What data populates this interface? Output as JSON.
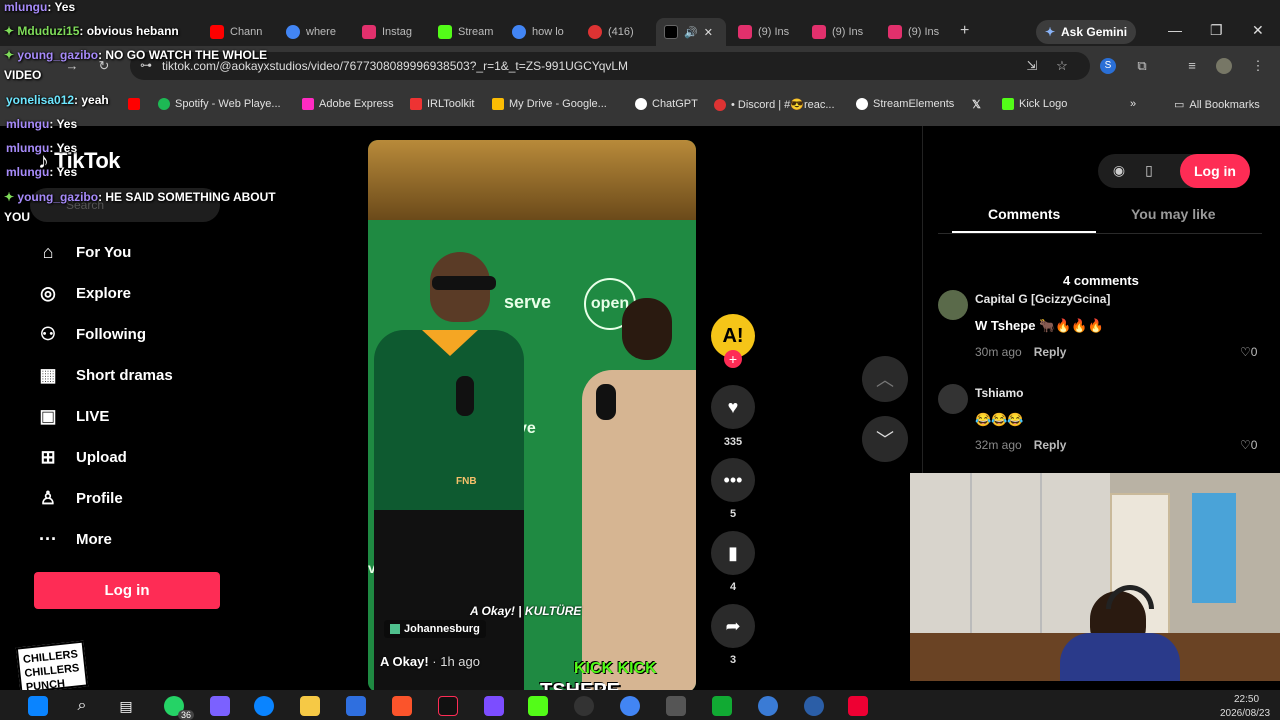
{
  "browser": {
    "tabs": [
      {
        "label": "Chann",
        "color": "#ff0000"
      },
      {
        "label": "where",
        "color": "#4285f4"
      },
      {
        "label": "Instag",
        "color": "#e1306c"
      },
      {
        "label": "Stream",
        "color": "#53fc18"
      },
      {
        "label": "how lo",
        "color": "#4285f4"
      },
      {
        "label": "(416)",
        "color": "#d33"
      },
      {
        "label": "",
        "color": "#000000"
      },
      {
        "label": "(9) Ins",
        "color": "#e1306c"
      },
      {
        "label": "(9) Ins",
        "color": "#e1306c"
      },
      {
        "label": "(9) Ins",
        "color": "#e1306c"
      }
    ],
    "gemini_label": "Ask Gemini",
    "url": "tiktok.com/@aokayxstudios/video/7677308089996938503?_r=1&_t=ZS-991UGCYqvLM",
    "bookmarks": [
      {
        "label": "Spotify - Web Playe...",
        "color": "#1db954"
      },
      {
        "label": "Adobe Express",
        "color": "#ff2bc2"
      },
      {
        "label": "IRLToolkit",
        "color": "#e33"
      },
      {
        "label": "My Drive - Google...",
        "color": "#fbbc04"
      },
      {
        "label": "ChatGPT",
        "color": "#ffffff"
      },
      {
        "label": "• Discord | #😎reac...",
        "color": "#d33"
      },
      {
        "label": "StreamElements",
        "color": "#ffffff"
      },
      {
        "label": "Kick Logo",
        "color": "#53fc18"
      }
    ],
    "all_bookmarks": "All Bookmarks"
  },
  "tiktok": {
    "logo": "TikTok",
    "search_placeholder": "Search",
    "nav": [
      {
        "label": "For You",
        "icon": "home-icon"
      },
      {
        "label": "Explore",
        "icon": "compass-icon"
      },
      {
        "label": "Following",
        "icon": "following-icon"
      },
      {
        "label": "Short dramas",
        "icon": "film-icon"
      },
      {
        "label": "LIVE",
        "icon": "live-icon"
      },
      {
        "label": "Upload",
        "icon": "upload-icon"
      },
      {
        "label": "Profile",
        "icon": "profile-icon"
      },
      {
        "label": "More",
        "icon": "more-icon"
      }
    ],
    "login_label": "Log in",
    "video": {
      "author": "A Okay!",
      "time": "· 1h ago",
      "location": "Johannesburg",
      "brand": "A Okay! | KULTÜRE",
      "banner_words": [
        "serve",
        "open",
        "ve",
        "ve"
      ],
      "fnb": "FNB"
    },
    "actions": [
      {
        "icon": "heart-icon",
        "count": "335"
      },
      {
        "icon": "comment-icon",
        "count": "5"
      },
      {
        "icon": "bookmark-icon",
        "count": "4"
      },
      {
        "icon": "share-icon",
        "count": "3"
      }
    ]
  },
  "panel": {
    "login_label": "Log in",
    "tabs": [
      "Comments",
      "You may like"
    ],
    "comment_count": "4 comments",
    "comments": [
      {
        "name": "Capital G [GcizzyGcina]",
        "text": "W Tshepe 🐂🔥🔥🔥",
        "time": "30m ago",
        "reply": "Reply",
        "likes": "0",
        "avatar": "#5a6a4a"
      },
      {
        "name": "Tshiamo",
        "text": "😂😂😂",
        "time": "32m ago",
        "reply": "Reply",
        "likes": "0",
        "avatar": "#333333"
      }
    ]
  },
  "chat": [
    {
      "user": "mlungu",
      "msg": ": Yes",
      "badge": false
    },
    {
      "user": "Mduduzi15",
      "msg": ": obvious hebann",
      "badge": true
    },
    {
      "user": "young_gazibo",
      "msg": ": NO GO WATCH THE WHOLE",
      "badge": true
    },
    {
      "user": "",
      "msg": "VIDEO",
      "badge": false
    },
    {
      "user": "yonelisa012",
      "msg": ": yeah",
      "badge": false
    },
    {
      "user": "mlungu",
      "msg": ": Yes",
      "badge": false
    },
    {
      "user": "mlungu",
      "msg": ": Yes",
      "badge": false
    },
    {
      "user": "mlungu",
      "msg": ": Yes",
      "badge": false
    },
    {
      "user": "young_gazibo",
      "msg": ": HE SAID SOMETHING ABOUT",
      "badge": true
    },
    {
      "user": "",
      "msg": "YOU",
      "badge": false
    }
  ],
  "overlay": {
    "kick_top": "KICK KICK",
    "kick_bottom": "TSHEPE",
    "stamp_line1": "CHILLERS",
    "stamp_line2": "PUNCH"
  },
  "taskbar": {
    "clock_time": "22:50",
    "clock_date": "2026/08/23",
    "badge_count": "36"
  }
}
